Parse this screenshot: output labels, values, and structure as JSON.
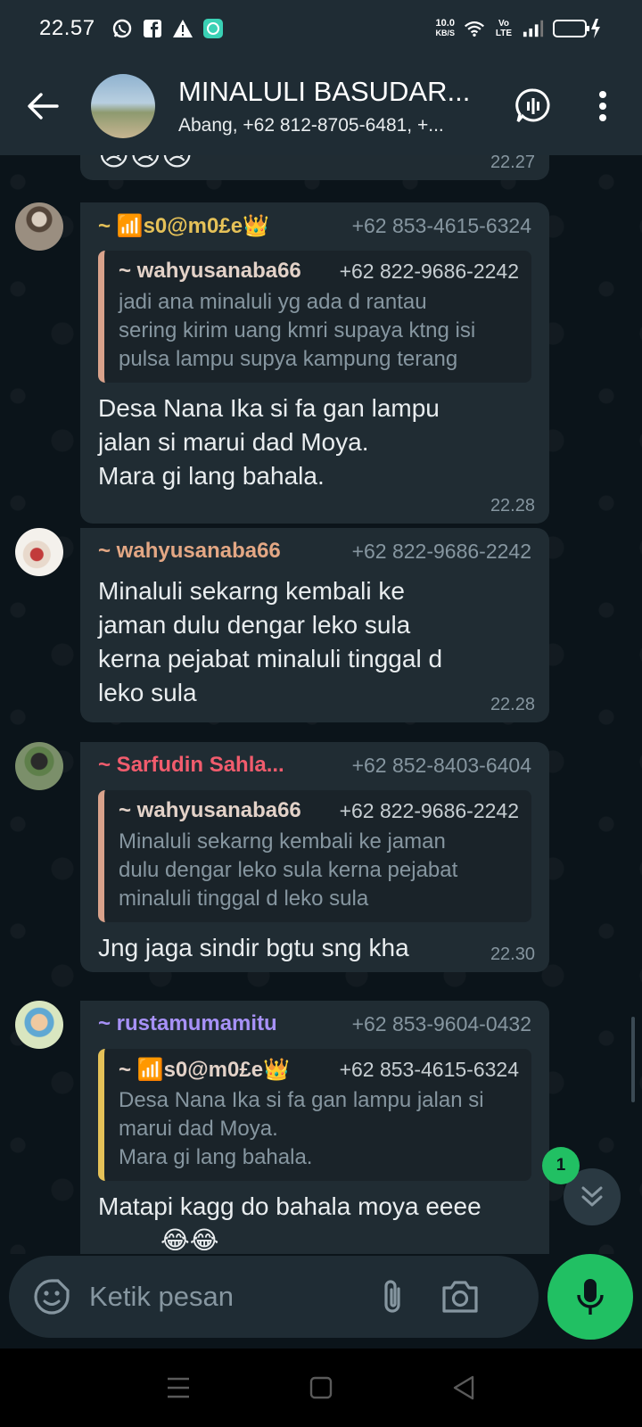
{
  "status_bar": {
    "time": "22.57",
    "net_speed_value": "10.0",
    "net_speed_unit": "KB/S",
    "volte": "Vo LTE",
    "icons": [
      "whatsapp-icon",
      "facebook-icon",
      "warning-icon",
      "app-icon",
      "wifi-icon",
      "signal-icon",
      "battery-icon"
    ]
  },
  "header": {
    "title": "MINALULI BASUDAR...",
    "subtitle": "Abang, +62 812-8705-6481, +..."
  },
  "messages": [
    {
      "sender": "~ 📶s0@m0£e👑",
      "sender_color": "#e5c158",
      "phone": "+62 853-4615-6324",
      "quote": {
        "sender": "~ wahyusanaba66",
        "phone": "+62 822-9686-2242",
        "text": "jadi ana minaluli yg ada d rantau\nsering kirim uang kmri supaya ktng isi\npulsa lampu supya kampung terang",
        "bar_color": "#d9a28b"
      },
      "text": "Desa Nana Ika si fa gan lampu\njalan si marui dad Moya.\nMara gi lang bahala.",
      "time": "22.28"
    },
    {
      "sender": "~ wahyusanaba66",
      "sender_color": "#e3a784",
      "phone": "+62 822-9686-2242",
      "text": "Minaluli sekarng kembali ke\njaman dulu dengar leko sula\nkerna pejabat minaluli  tinggal d\nleko sula",
      "time": "22.28"
    },
    {
      "sender": "~ Sarfudin Sahla...",
      "sender_color": "#f15c6d",
      "phone": "+62 852-8403-6404",
      "quote": {
        "sender": "~ wahyusanaba66",
        "phone": "+62 822-9686-2242",
        "text": "Minaluli sekarng kembali ke jaman\ndulu dengar leko sula kerna pejabat\nminaluli  tinggal d leko sula",
        "bar_color": "#d9a28b"
      },
      "text": "Jng jaga sindir bgtu sng kha",
      "time": "22.30"
    },
    {
      "sender": "~ rustamumamitu",
      "sender_color": "#a791f7",
      "phone": "+62 853-9604-0432",
      "quote": {
        "sender": "~ 📶s0@m0£e👑",
        "phone": "+62 853-4615-6324",
        "text": "Desa Nana Ika si fa gan lampu jalan si\nmarui dad Moya.\nMara gi lang bahala.",
        "bar_color": "#e5c158"
      },
      "text": "Matapi kagg do bahala moya eeee",
      "time": ""
    }
  ],
  "previous_message_time": "22.27",
  "previous_emojis": "😢😢😢",
  "partial_emojis": "😂😂",
  "unread_count": "1",
  "input": {
    "placeholder": "Ketik pesan"
  },
  "colors": {
    "accent_green": "#21c063",
    "bubble_bg": "#202c33",
    "header_bg": "#1f2c34"
  }
}
